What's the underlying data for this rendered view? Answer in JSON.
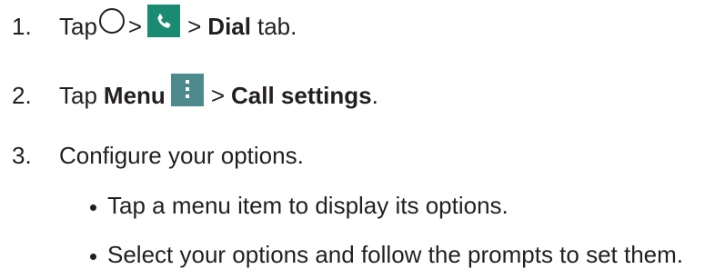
{
  "steps": [
    {
      "number": "1.",
      "text_tap": "Tap",
      "sep1": ">",
      "sep2": ">",
      "bold_dial": "Dial",
      "text_tab": "tab."
    },
    {
      "number": "2.",
      "text_tap": "Tap",
      "bold_menu": "Menu",
      "sep": ">",
      "bold_call_settings": "Call settings",
      "period": "."
    },
    {
      "number": "3.",
      "text": "Configure your options."
    }
  ],
  "bullets": [
    "Tap a menu item to display its options.",
    "Select your options and follow the prompts to set them."
  ],
  "icons": {
    "home": "home-circle-icon",
    "phone": "phone-icon",
    "menu": "menu-icon",
    "phone_color": "#1a8a72",
    "menu_color": "#4c8a8c"
  }
}
